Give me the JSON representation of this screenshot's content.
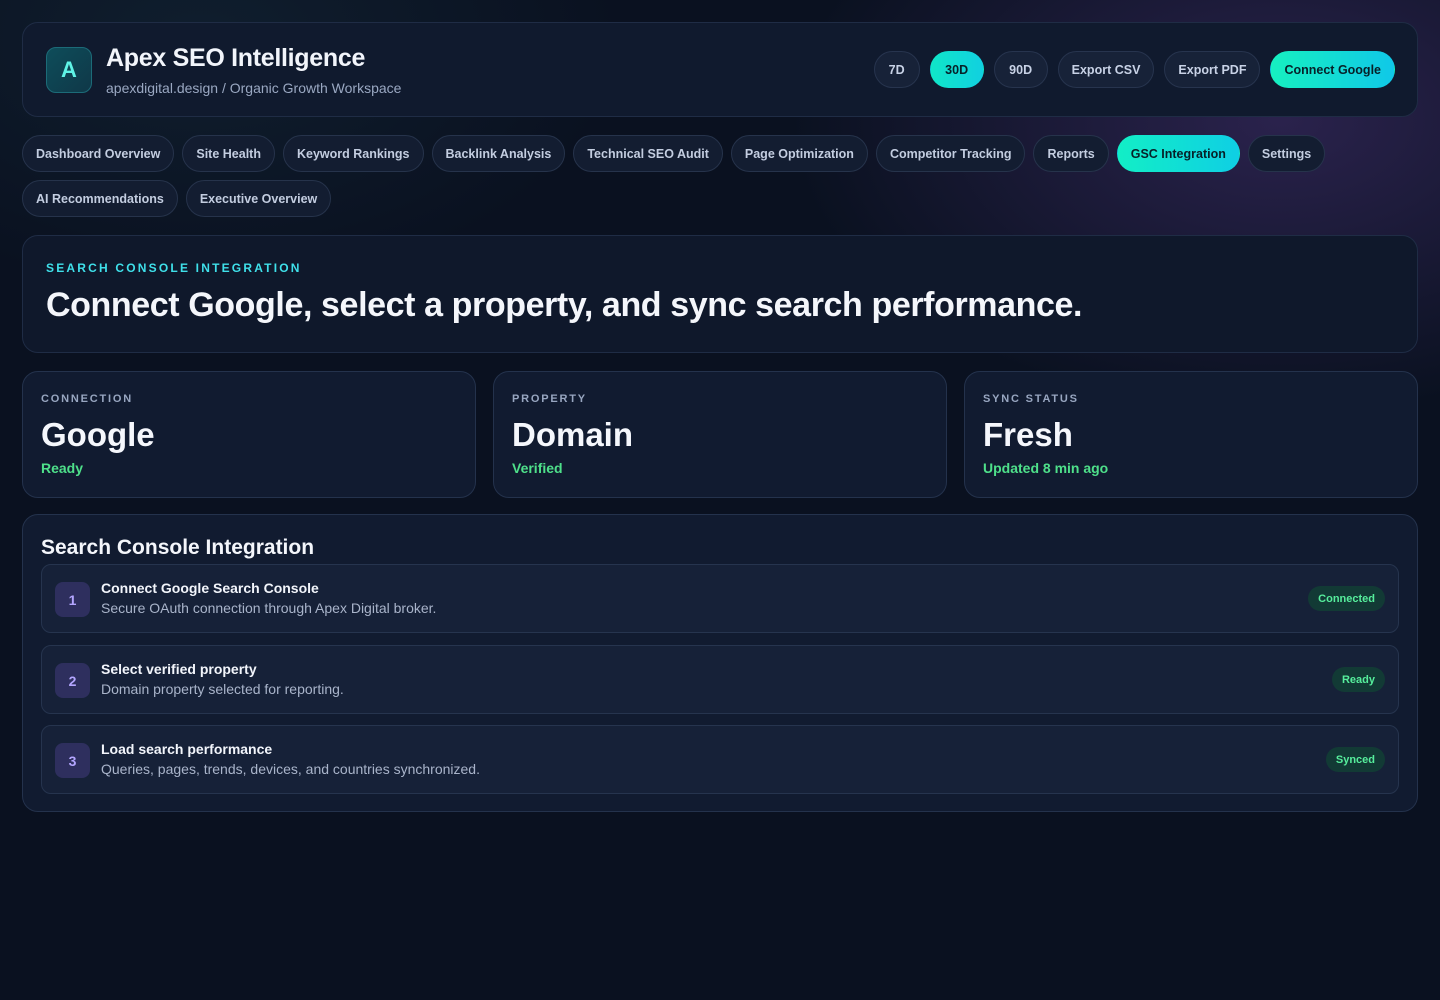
{
  "app": {
    "logo_letter": "A",
    "title": "Apex SEO Intelligence",
    "subtitle": "apexdigital.design / Organic Growth Workspace"
  },
  "header_actions": {
    "range_7d": "7D",
    "range_30d": "30D",
    "range_90d": "90D",
    "selected_range": "30D",
    "export_csv": "Export CSV",
    "export_pdf": "Export PDF",
    "connect_google": "Connect Google"
  },
  "nav": {
    "active": "GSC Integration",
    "tabs": [
      {
        "label": "Dashboard Overview"
      },
      {
        "label": "Site Health"
      },
      {
        "label": "Keyword Rankings"
      },
      {
        "label": "Backlink Analysis"
      },
      {
        "label": "Technical SEO Audit"
      },
      {
        "label": "Page Optimization"
      },
      {
        "label": "Competitor Tracking"
      },
      {
        "label": "Reports"
      },
      {
        "label": "GSC Integration"
      },
      {
        "label": "Settings"
      },
      {
        "label": "AI Recommendations"
      },
      {
        "label": "Executive Overview"
      }
    ]
  },
  "hero": {
    "eyebrow": "SEARCH CONSOLE INTEGRATION",
    "title": "Connect Google, select a property, and sync search performance."
  },
  "stats": [
    {
      "label": "CONNECTION",
      "value": "Google",
      "note": "Ready"
    },
    {
      "label": "PROPERTY",
      "value": "Domain",
      "note": "Verified"
    },
    {
      "label": "SYNC STATUS",
      "value": "Fresh",
      "note": "Updated 8 min ago"
    }
  ],
  "integration": {
    "title": "Search Console Integration",
    "steps": [
      {
        "number": "1",
        "title": "Connect Google Search Console",
        "description": "Secure OAuth connection through Apex Digital broker.",
        "status": "Connected"
      },
      {
        "number": "2",
        "title": "Select verified property",
        "description": "Domain property selected for reporting.",
        "status": "Ready"
      },
      {
        "number": "3",
        "title": "Load search performance",
        "description": "Queries, pages, trends, devices, and countries synchronized.",
        "status": "Synced"
      }
    ]
  },
  "colors": {
    "background": "#0a1120",
    "accent": "#12eec6",
    "success": "#4ee08a",
    "eyebrow": "#3fe0ea"
  }
}
